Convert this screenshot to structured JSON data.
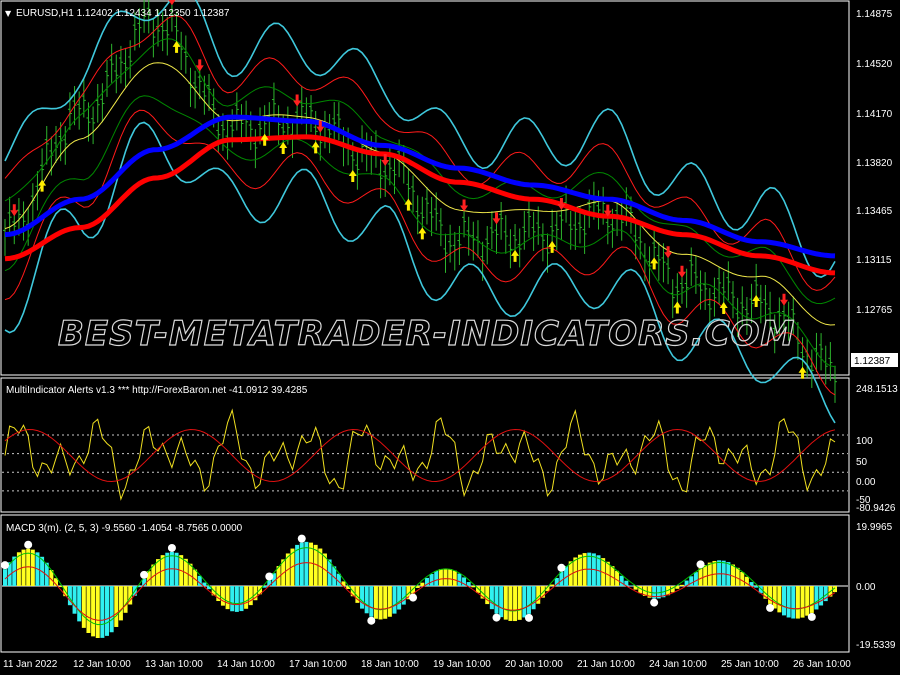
{
  "colors": {
    "background": "#000000",
    "frame": "#ffffff",
    "candles": "#2db52d",
    "ma_fast": "#0000ff",
    "ma_slow": "#ff0000",
    "band_outer": "#3fc8dc",
    "band_mid": "#ff1a1a",
    "band_inner": "#008800",
    "band_center": "#f0e84a",
    "osc_yellow": "#f0e020",
    "osc_red": "#e01010",
    "macd_cyan": "#30f0f0",
    "macd_yellow": "#ffff20",
    "arrow_up": "#ffee00",
    "arrow_down": "#ff2020",
    "price_box": "#ffffff"
  },
  "main_panel": {
    "header": "EURUSD,H1  1.12402 1.12434 1.12350 1.12387",
    "watermark": "BEST-METATRADER-INDICATORS.COM",
    "price_ticks": [
      "1.14875",
      "1.14520",
      "1.14170",
      "1.13820",
      "1.13465",
      "1.13115",
      "1.12765"
    ],
    "current_price": "1.12387"
  },
  "osc_panel": {
    "header": "MultiIndicator Alerts v1.3 *** http://ForexBaron.net -41.0912 39.4285",
    "ticks": [
      "248.1513",
      "100",
      "50",
      "0.00",
      "-50",
      "-80.9426"
    ]
  },
  "macd_panel": {
    "header": "MACD 3(m). (2, 5, 3) -9.5560 -1.4054 -8.7565 0.0000",
    "ticks": [
      "19.9965",
      "0.00",
      "-19.5339"
    ]
  },
  "time_axis": [
    "11 Jan 2022",
    "12 Jan 10:00",
    "13 Jan 10:00",
    "14 Jan 10:00",
    "17 Jan 10:00",
    "18 Jan 10:00",
    "19 Jan 10:00",
    "20 Jan 10:00",
    "21 Jan 10:00",
    "24 Jan 10:00",
    "25 Jan 10:00",
    "26 Jan 10:00"
  ],
  "chart_data": {
    "type": "line",
    "symbol": "EURUSD",
    "timeframe": "H1",
    "ylim": [
      1.1238,
      1.1495
    ],
    "x": [
      "11 Jan 2022",
      "12 Jan 10:00",
      "13 Jan 10:00",
      "14 Jan 10:00",
      "17 Jan 10:00",
      "18 Jan 10:00",
      "19 Jan 10:00",
      "20 Jan 10:00",
      "21 Jan 10:00",
      "24 Jan 10:00",
      "25 Jan 10:00",
      "26 Jan 10:00"
    ],
    "price_path": [
      1.1335,
      1.142,
      1.1485,
      1.141,
      1.1415,
      1.1385,
      1.133,
      1.1335,
      1.135,
      1.13,
      1.1285,
      1.1239
    ],
    "ma_fast": [
      1.1335,
      1.136,
      1.1395,
      1.1418,
      1.1415,
      1.1398,
      1.1382,
      1.137,
      1.136,
      1.1345,
      1.133,
      1.132
    ],
    "ma_slow": [
      1.1318,
      1.134,
      1.1375,
      1.1402,
      1.1404,
      1.1392,
      1.1372,
      1.136,
      1.1348,
      1.1335,
      1.132,
      1.1308
    ]
  }
}
